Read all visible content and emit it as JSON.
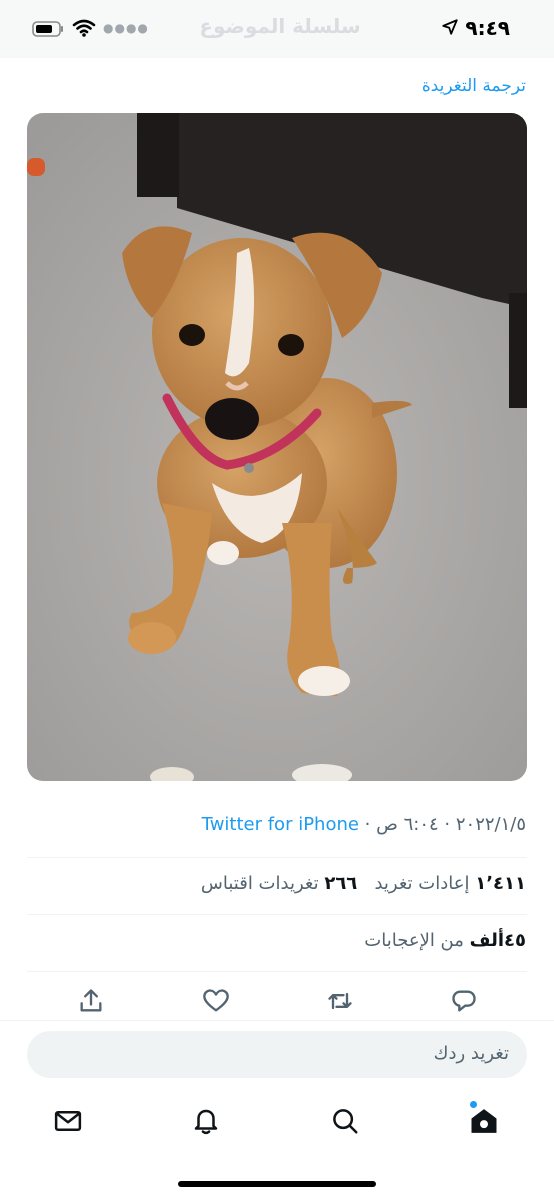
{
  "status_bar": {
    "time": "٩:٤٩",
    "faded_title": "سلسلة الموضوع"
  },
  "tweet": {
    "translate_label": "ترجمة التغريدة",
    "timestamp": "٢٠٢٢/١/٥ · ٦:٠٤ ص · ",
    "source": "Twitter for iPhone",
    "retweets_count": "١٬٤١١",
    "retweets_label": "إعادات تغريد",
    "quotes_count": "٢٦٦",
    "quotes_label": "تغريدات اقتباس",
    "likes_count": "٤٥ألف",
    "likes_label": "من الإعجابات"
  },
  "reply": {
    "placeholder": "تغريد ردك"
  },
  "icons": {
    "share": "share-icon",
    "like": "heart-icon",
    "retweet": "retweet-icon",
    "reply": "reply-icon",
    "messages": "mail-icon",
    "notifications": "bell-icon",
    "search": "search-icon",
    "home": "home-icon"
  },
  "colors": {
    "accent": "#1d9bf0",
    "secondary_text": "#536471",
    "primary_text": "#0f1419"
  }
}
